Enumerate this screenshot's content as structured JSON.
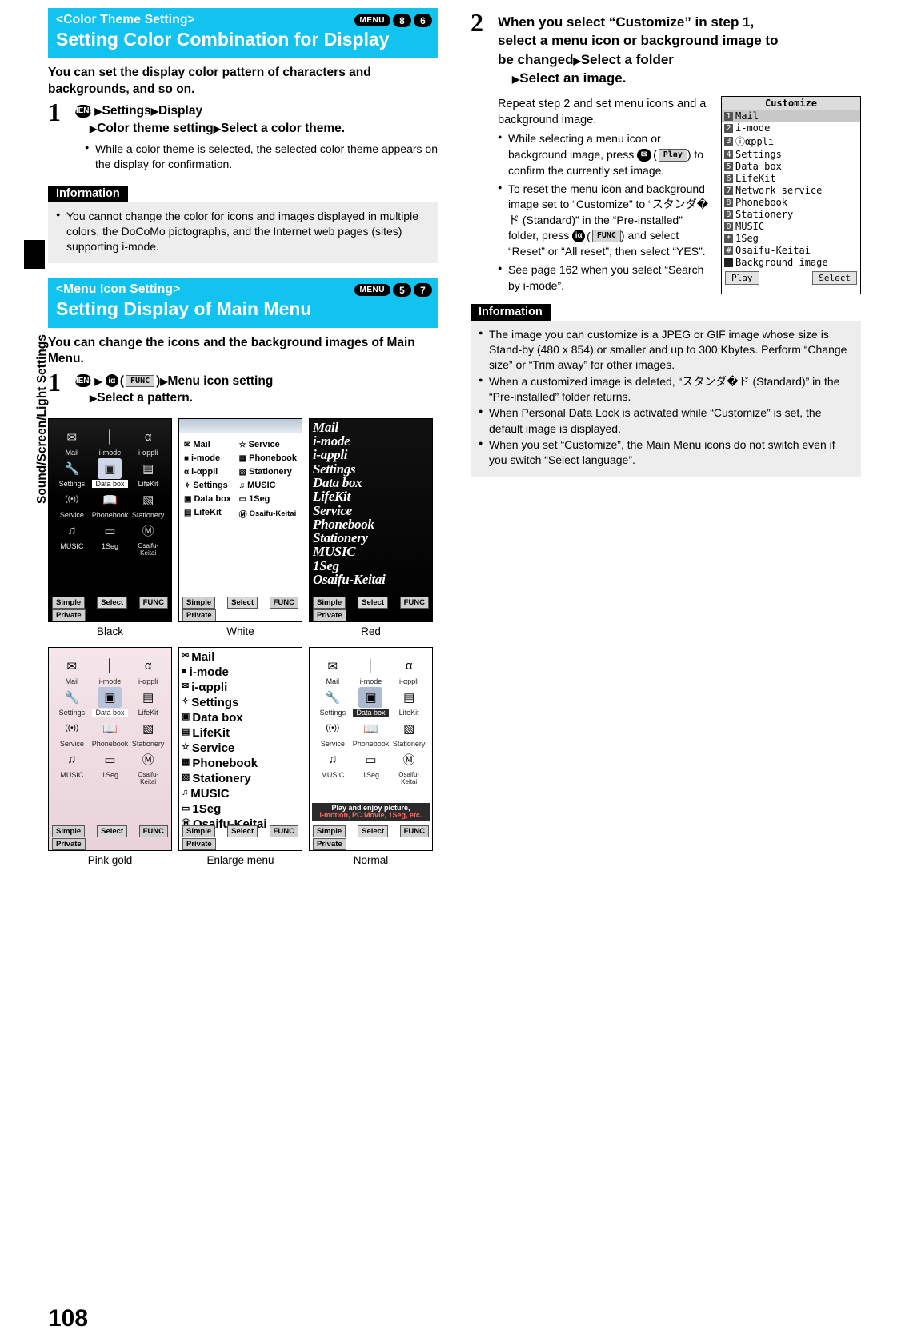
{
  "page": {
    "number": "108",
    "side_tab": "Sound/Screen/Light Settings"
  },
  "left": {
    "section1": {
      "tag": "<Color Theme Setting>",
      "title": "Setting Color Combination for Display",
      "keyref": {
        "menu": "MENU",
        "d1": "8",
        "d2": "6"
      },
      "lead": "You can set the display color pattern of characters and backgrounds, and so on.",
      "step": {
        "number": "1",
        "line1_a": "Settings",
        "line1_b": "Display",
        "line2_a": "Color theme setting",
        "line2_b": "Select a color theme.",
        "menu_key": "MENU",
        "bullet": "While a color theme is selected, the selected color theme appears on the display for confirmation."
      },
      "information": {
        "label": "Information",
        "items": [
          "You cannot change the color for icons and images displayed in multiple colors, the DoCoMo pictographs, and the Internet web pages (sites) supporting i-mode."
        ]
      }
    },
    "section2": {
      "tag": "<Menu Icon Setting>",
      "title": "Setting Display of Main Menu",
      "keyref": {
        "menu": "MENU",
        "d1": "5",
        "d2": "7"
      },
      "lead": "You can change the icons and the background images of Main Menu.",
      "step": {
        "number": "1",
        "menu_key": "MENU",
        "func_key": "FUNC",
        "line1": "Menu icon setting",
        "line2": "Select a pattern."
      },
      "themes": [
        {
          "caption": "Black",
          "id": "black"
        },
        {
          "caption": "White",
          "id": "white"
        },
        {
          "caption": "Red",
          "id": "red"
        },
        {
          "caption": "Pink gold",
          "id": "pinkgold"
        },
        {
          "caption": "Enlarge menu",
          "id": "enlarge"
        },
        {
          "caption": "Normal",
          "id": "normal"
        }
      ],
      "menu_icons": [
        {
          "label": "Mail",
          "glyph": "✉"
        },
        {
          "label": "i-mode",
          "glyph": "ⓘ"
        },
        {
          "label": "i-αppli",
          "glyph": "α"
        },
        {
          "label": "Settings",
          "glyph": "⚙"
        },
        {
          "label": "Data box",
          "glyph": "▣"
        },
        {
          "label": "LifeKit",
          "glyph": "▤"
        },
        {
          "label": "Service",
          "glyph": "((•))"
        },
        {
          "label": "Phonebook",
          "glyph": "▥"
        },
        {
          "label": "Stationery",
          "glyph": "▧"
        },
        {
          "label": "MUSIC",
          "glyph": "♫"
        },
        {
          "label": "1Seg",
          "glyph": "▭"
        },
        {
          "label": "Osaifu-Keitai",
          "glyph": "Ⓖ"
        }
      ],
      "white_list": [
        "Mail",
        "i-mode",
        "i-αppli",
        "Settings",
        "Data box",
        "LifeKit",
        "Service",
        "Phonebook",
        "Stationery",
        "MUSIC",
        "1Seg",
        "Osaifu-Keitai"
      ],
      "red_list": [
        "Mail",
        "i-mode",
        "i-appli",
        "Settings",
        "Data box",
        "LifeKit",
        "Service",
        "Phonebook",
        "Stationery",
        "MUSIC",
        "1Seg",
        "Osaifu-Keitai"
      ],
      "enlarge_list": [
        "Mail",
        "i-mode",
        "i-αppli",
        "Settings",
        "Data box",
        "LifeKit",
        "Service",
        "Phonebook",
        "Stationery",
        "MUSIC",
        "1Seg",
        "Osaifu-Keitai"
      ],
      "softkeys": {
        "left": "Simple",
        "left2": "Private",
        "center": "Select",
        "right": "FUNC"
      },
      "normal_banner_l1": "Play and enjoy picture,",
      "normal_banner_l2": "i-motion, PC Movie, 1Seg, etc."
    }
  },
  "right": {
    "step": {
      "number": "2",
      "line1": "When you select “Customize” in step 1,",
      "line2": "select a menu icon or background image to",
      "line3_a": "be changed",
      "line3_b": "Select a folder",
      "line4": "Select an image.",
      "intro": "Repeat step 2 and set menu icons and a background image.",
      "bullets": [
        {
          "pre": "While selecting a menu icon or background image, press",
          "key": "Play",
          "post": ") to confirm the currently set image."
        },
        {
          "pre": "To reset the menu icon and background image set to “Customize” to “スタンダ�ド (Standard)” in the “Pre-installed” folder, press",
          "key": "FUNC",
          "post": ") and select “Reset” or “All reset”, then select “YES”."
        },
        {
          "pre": "See page 162 when you select “Search by i-mode”.",
          "key": "",
          "post": ""
        }
      ]
    },
    "customize_screen": {
      "title": "Customize",
      "rows": [
        {
          "n": "1",
          "label": "Mail"
        },
        {
          "n": "2",
          "label": "i-mode"
        },
        {
          "n": "3",
          "label": "ⓘαppli"
        },
        {
          "n": "4",
          "label": "Settings"
        },
        {
          "n": "5",
          "label": "Data box"
        },
        {
          "n": "6",
          "label": "LifeKit"
        },
        {
          "n": "7",
          "label": "Network service"
        },
        {
          "n": "8",
          "label": "Phonebook"
        },
        {
          "n": "9",
          "label": "Stationery"
        },
        {
          "n": "0",
          "label": "MUSIC"
        },
        {
          "n": "*",
          "label": "1Seg"
        },
        {
          "n": "#",
          "label": "Osaifu-Keitai"
        },
        {
          "n": "",
          "label": "Background image"
        }
      ],
      "left_button": "Play",
      "right_button": "Select"
    },
    "information": {
      "label": "Information",
      "items": [
        "The image you can customize is a JPEG or GIF image whose size is Stand-by (480 x 854) or smaller and up to 300 Kbytes. Perform “Change size” or “Trim away” for other images.",
        "When a customized image is deleted, “スタンダ�ド (Standard)” in the “Pre-installed” folder returns.",
        "When Personal Data Lock is activated while “Customize” is set, the default image is displayed.",
        "When you set “Customize”, the Main Menu icons do not switch even if you switch “Select language”."
      ]
    }
  }
}
